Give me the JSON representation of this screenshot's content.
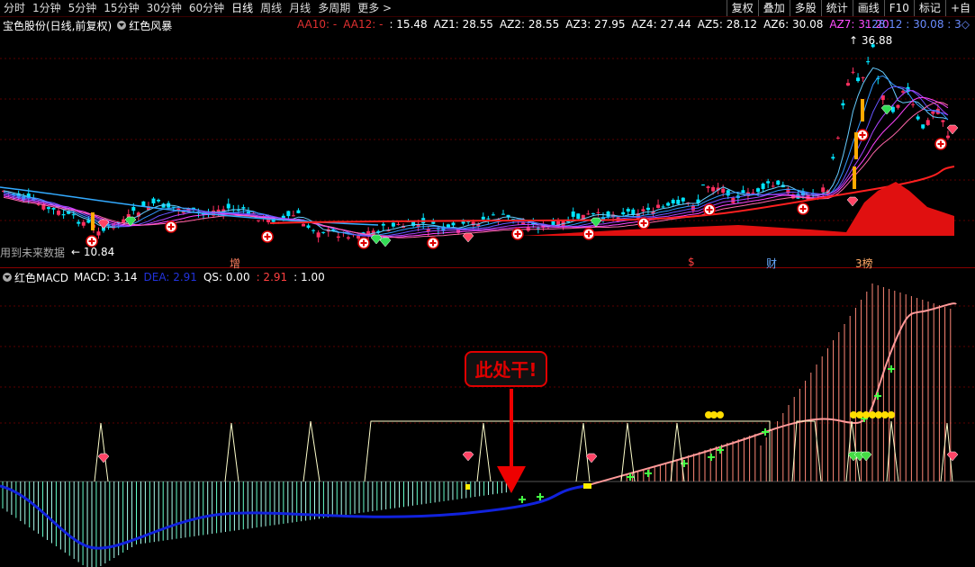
{
  "toolbar": {
    "periods": [
      "分时",
      "1分钟",
      "5分钟",
      "15分钟",
      "30分钟",
      "60分钟",
      "日线",
      "周线",
      "月线",
      "多周期",
      "更多 >"
    ],
    "active": "日线",
    "right": [
      "复权",
      "叠加",
      "多股",
      "统计",
      "画线",
      "F10",
      "标记",
      "+自"
    ]
  },
  "main": {
    "stock_label": "宝色股份(日线,前复权)",
    "indicator_name": "红色风暴",
    "values": [
      {
        "label": "AA10: -",
        "color": "#e03030"
      },
      {
        "label": "AA12: -",
        "color": "#e03030"
      },
      {
        "label": ": 15.48",
        "color": "#ffffff"
      },
      {
        "label": "AZ1: 28.55",
        "color": "#ffffff"
      },
      {
        "label": "AZ2: 28.55",
        "color": "#ffffff"
      },
      {
        "label": "AZ3: 27.95",
        "color": "#ffffff"
      },
      {
        "label": "AZ4: 27.44",
        "color": "#ffffff"
      },
      {
        "label": "AZ5: 28.12",
        "color": "#ffffff"
      },
      {
        "label": "AZ6: 30.08",
        "color": "#ffffff"
      },
      {
        "label": "AZ7: 31.20",
        "color": "#ff4dff"
      }
    ],
    "right_values": ": 28.12 : 30.08 : 3◇",
    "high_label": "36.88",
    "low_label": "10.84",
    "future_note": "用到未来数据",
    "tags": [
      {
        "text": "增",
        "color": "#ff8060"
      },
      {
        "text": "$",
        "color": "#ff4040"
      },
      {
        "text": "财",
        "color": "#66aaff"
      },
      {
        "text": "3榜",
        "color": "#ffaa66"
      }
    ]
  },
  "macd": {
    "name": "红色MACD",
    "values": [
      {
        "label": "MACD: 3.14",
        "color": "#ffffff"
      },
      {
        "label": "DEA: 2.91",
        "color": "#2233dd"
      },
      {
        "label": "QS: 0.00",
        "color": "#ffffff"
      },
      {
        "label": ": 2.91",
        "color": "#ff4040"
      },
      {
        "label": ": 1.00",
        "color": "#ffffff"
      }
    ],
    "callout": "此处干!"
  },
  "colors": {
    "up": "#ff3030",
    "down": "#00ffff",
    "dea": "#1122cc",
    "accent": "#e00000"
  }
}
